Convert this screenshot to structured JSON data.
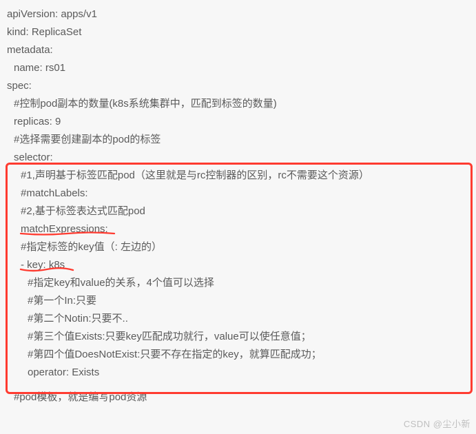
{
  "lines": {
    "l0": "apiVersion: apps/v1",
    "l1": "kind: ReplicaSet",
    "l2": "metadata:",
    "l3": "name: rs01",
    "l4": "spec:",
    "l5": "#控制pod副本的数量(k8s系统集群中，匹配到标签的数量)",
    "l6": "replicas: 9",
    "l7": "#选择需要创建副本的pod的标签",
    "l8": "selector:",
    "l9": "#1,声明基于标签匹配pod（这里就是与rc控制器的区别，rc不需要这个资源）",
    "l10": "#matchLabels:",
    "l11": "#2,基于标签表达式匹配pod",
    "l12": "matchExpressions:",
    "l13": "#指定标签的key值（: 左边的）",
    "l14": "- key: k8s",
    "l15": "#指定key和value的关系，4个值可以选择",
    "l16": "#第一个In:只要",
    "l17": "#第二个Notin:只要不..",
    "l18": "#第三个值Exists:只要key匹配成功就行，value可以使任意值；",
    "l19": "#第四个值DoesNotExist:只要不存在指定的key，就算匹配成功；",
    "l20": "operator: Exists",
    "l21": "#pod模板，就是编写pod资源"
  },
  "watermark": "CSDN @尘小新"
}
